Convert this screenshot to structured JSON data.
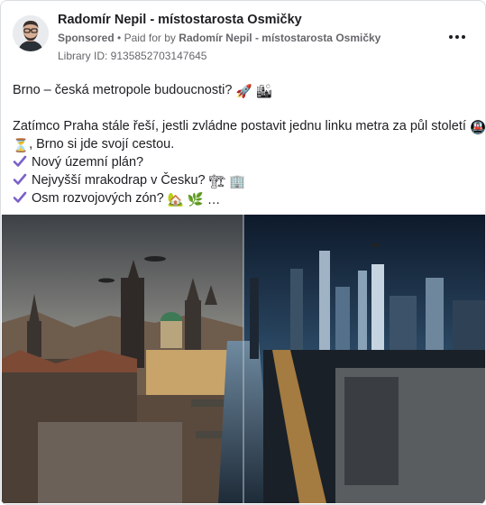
{
  "post": {
    "author_name": "Radomír Nepil - místostarosta Osmičky",
    "sponsored_label": "Sponsored",
    "separator": "•",
    "paid_for_prefix": "Paid for by",
    "paid_for_by": "Radomír Nepil - místostarosta Osmičky",
    "library_id": "Library ID: 9135852703147645",
    "more_icon": "more-horizontal-icon",
    "text": {
      "line1": "Brno – česká metropole budoucnosti?",
      "line1_emojis": "🚀 🏙",
      "line2": "Zatímco Praha stále řeší, jestli zvládne postavit jednu linku metra za půl století",
      "line2_emoji": "🚇",
      "line3_emoji": "⏳",
      "line3": ", Brno si jde svojí cestou.",
      "bullets": [
        {
          "text": "Nový územní plán?",
          "emojis": ""
        },
        {
          "text": "Nejvyšší mrakodrap v Česku?",
          "emojis": "🏗 🏢"
        },
        {
          "text": "Osm rozvojových zón?",
          "emojis": "🏡 🌿 …"
        }
      ]
    },
    "image_description_icon": "city-split-illustration"
  },
  "colors": {
    "text": "#1c1e21",
    "meta": "#65676b",
    "check": "#7b61c9",
    "border": "#dadde1"
  }
}
